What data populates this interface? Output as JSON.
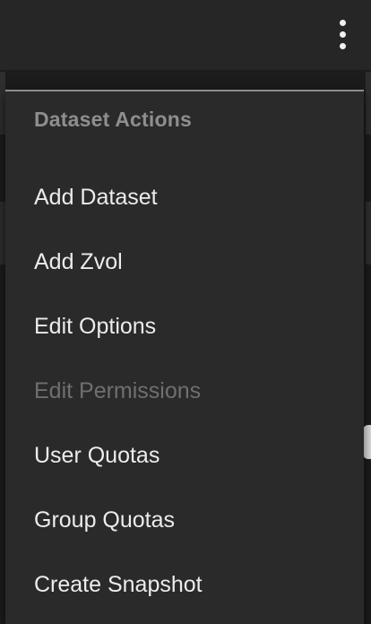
{
  "topbar": {
    "menu_icon": "more-vert-icon"
  },
  "menu": {
    "header": "Dataset Actions",
    "items": [
      {
        "label": "Add Dataset",
        "enabled": true
      },
      {
        "label": "Add Zvol",
        "enabled": true
      },
      {
        "label": "Edit Options",
        "enabled": true
      },
      {
        "label": "Edit Permissions",
        "enabled": false
      },
      {
        "label": "User Quotas",
        "enabled": true
      },
      {
        "label": "Group Quotas",
        "enabled": true
      },
      {
        "label": "Create Snapshot",
        "enabled": true
      }
    ]
  },
  "colors": {
    "background": "#1c1c1c",
    "topbar": "#262626",
    "menu_background": "#2a2a2a",
    "menu_text": "#ececec",
    "menu_text_disabled": "#6f6f6f",
    "menu_header": "#8e8e8e"
  }
}
